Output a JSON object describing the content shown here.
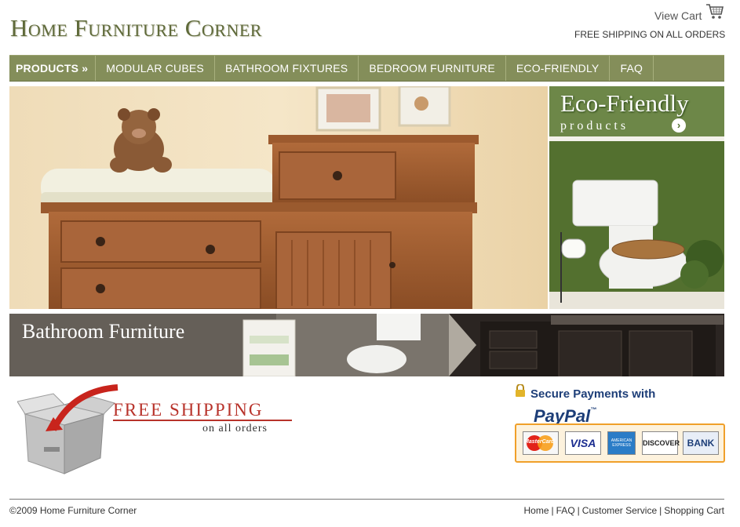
{
  "header": {
    "logo": "Home Furniture Corner",
    "view_cart": "View Cart",
    "cart_icon": "cart-icon",
    "free_shipping_note": "FREE SHIPPING ON ALL ORDERS"
  },
  "nav": {
    "items": [
      {
        "label": "PRODUCTS »"
      },
      {
        "label": "MODULAR CUBES"
      },
      {
        "label": "BATHROOM FIXTURES"
      },
      {
        "label": "BEDROOM FURNITURE"
      },
      {
        "label": "ECO-FRIENDLY"
      },
      {
        "label": "FAQ"
      }
    ]
  },
  "banners": {
    "eco_title": "Eco-Friendly",
    "eco_subtitle": "products",
    "bathroom_title": "Bathroom Furniture"
  },
  "promo": {
    "free_shipping_title": "FREE SHIPPING",
    "free_shipping_sub": "on all orders",
    "secure_payments": "Secure Payments with",
    "paypal": "PayPal",
    "paypal_tm": "™",
    "cards": [
      "MasterCard",
      "VISA",
      "AMERICAN EXPRESS",
      "DISCOVER",
      "BANK"
    ]
  },
  "footer": {
    "copyright": "©2009 Home Furniture Corner",
    "links": [
      "Home",
      "FAQ",
      "Customer Service",
      "Shopping Cart"
    ],
    "separator": "|"
  },
  "colors": {
    "brand_green": "#848e5a",
    "logo_green": "#5f6a3a",
    "promo_red": "#b8332b",
    "paypal_navy": "#1d3e78",
    "paypal_orange": "#f0a02a"
  }
}
